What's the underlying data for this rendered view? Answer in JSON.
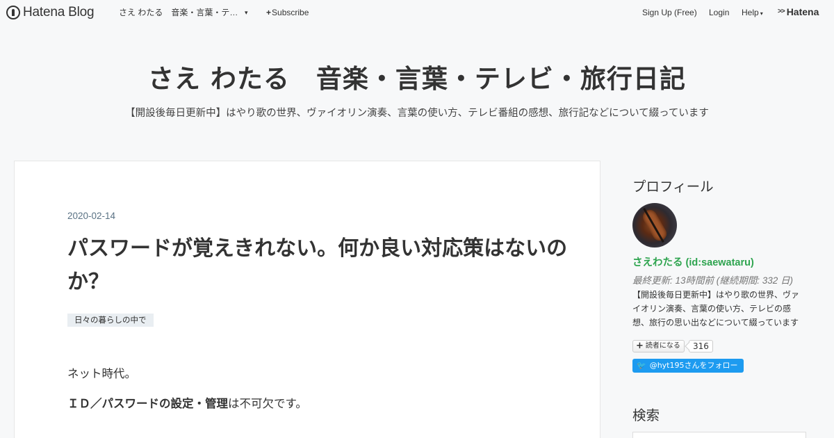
{
  "topbar": {
    "brand": "Hatena Blog",
    "blog_name_short": "さえ わたる　音楽・言葉・テ…",
    "caret": "▾",
    "subscribe_icon": "plus-icon",
    "subscribe": "Subscribe",
    "signup": "Sign Up (Free)",
    "login": "Login",
    "help": "Help",
    "hatena": "Hatena"
  },
  "header": {
    "title": "さえ わたる　音楽・言葉・テレビ・旅行日記",
    "description": "【開設後毎日更新中】はやり歌の世界、ヴァイオリン演奏、言葉の使い方、テレビ番組の感想、旅行記などについて綴っています"
  },
  "article": {
    "date": "2020-02-14",
    "title": "パスワードが覚えきれない。何か良い対応策はないのか？",
    "category": "日々の暮らしの中で",
    "body_p1": "ネット時代。",
    "body_p2_bold": "ＩＤ／パスワードの設定・管理",
    "body_p2_rest": "は不可欠です。"
  },
  "sidebar": {
    "profile_heading": "プロフィール",
    "profile_name": "さえわたる (id:saewataru)",
    "profile_updated": "最終更新: 13時間前 (継続期間: 332 日)",
    "profile_desc": "【開設後毎日更新中】はやり歌の世界、ヴァイオリン演奏、言葉の使い方、テレビの感想、旅行の思い出などについて綴っています",
    "reader_label": "読者になる",
    "reader_count": "316",
    "twitter_follow": "@hyt195さんをフォロー",
    "search_heading": "検索"
  },
  "colors": {
    "background": "#f7f8f9",
    "profile_name": "#2ea44f",
    "twitter": "#1d9bf0",
    "date": "#5a7284"
  }
}
